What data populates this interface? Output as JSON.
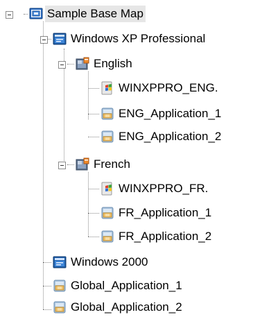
{
  "tree": {
    "root": {
      "label": "Sample Base Map",
      "icon": "base-map-icon",
      "expanded": true,
      "selected": true
    },
    "nodes": [
      {
        "label": "Windows XP Professional",
        "icon": "operating-system-icon",
        "expanded": true
      },
      {
        "label": "English",
        "icon": "locale-folder-icon",
        "expanded": true
      },
      {
        "label": "WINXPPRO_ENG.",
        "icon": "windows-flag-icon"
      },
      {
        "label": "ENG_Application_1",
        "icon": "application-package-icon"
      },
      {
        "label": "ENG_Application_2",
        "icon": "application-package-icon"
      },
      {
        "label": "French",
        "icon": "locale-folder-icon",
        "expanded": true
      },
      {
        "label": "WINXPPRO_FR.",
        "icon": "windows-flag-icon"
      },
      {
        "label": "FR_Application_1",
        "icon": "application-package-icon"
      },
      {
        "label": "FR_Application_2",
        "icon": "application-package-icon"
      },
      {
        "label": "Windows 2000",
        "icon": "operating-system-icon"
      },
      {
        "label": "Global_Application_1",
        "icon": "application-package-icon"
      },
      {
        "label": "Global_Application_2",
        "icon": "application-package-icon"
      }
    ]
  },
  "colors": {
    "selection": "#e6e6e6",
    "connector": "#8a8a8a",
    "icon_blue": "#1f5fa8"
  }
}
